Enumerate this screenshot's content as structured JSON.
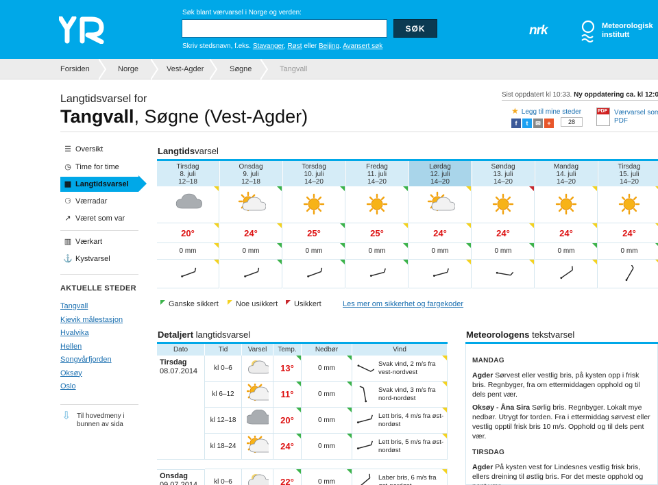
{
  "header": {
    "logo_text": "YR",
    "search_label": "Søk blant værvarsel i Norge og verden:",
    "search_value": "",
    "search_button": "SØK",
    "hint_prefix": "Skriv stedsnavn, f.eks.",
    "hint_link1": "Stavanger",
    "hint_comma": ",",
    "hint_link2": "Røst",
    "hint_or": "eller",
    "hint_link3": "Beijing",
    "hint_period": ".",
    "hint_link4": "Avansert søk",
    "nrk": "nrk",
    "met_line1": "Meteorologisk",
    "met_line2": "institutt"
  },
  "breadcrumb": [
    "Forsiden",
    "Norge",
    "Vest-Agder",
    "Søgne",
    "Tangvall"
  ],
  "title": {
    "pre": "Langtidsvarsel for",
    "place": "Tangvall",
    "rest": ", Søgne (Vest-Agder)"
  },
  "updated": {
    "last": "Sist oppdatert kl 10:33.",
    "next": "Ny oppdatering ca. kl 12:00"
  },
  "favourite": "Legg til mine steder",
  "share_count": "28",
  "pdf": {
    "badge": "PDF",
    "line1": "Værvarsel som",
    "line2": "PDF"
  },
  "sidebar": {
    "items": [
      {
        "icon": "list-icon",
        "glyph": "☰",
        "label": "Oversikt"
      },
      {
        "icon": "clock-icon",
        "glyph": "◷",
        "label": "Time for time"
      },
      {
        "icon": "calendar-icon",
        "glyph": "▦",
        "label": "Langtidsvarsel"
      },
      {
        "icon": "radar-icon",
        "glyph": "⚆",
        "label": "Værradar"
      },
      {
        "icon": "chart-icon",
        "glyph": "↗",
        "label": "Været som var"
      },
      {
        "icon": "map-icon",
        "glyph": "▥",
        "label": "Værkart"
      },
      {
        "icon": "anchor-icon",
        "glyph": "⚓",
        "label": "Kystvarsel"
      }
    ],
    "places_heading": "AKTUELLE STEDER",
    "places": [
      "Tangvall",
      "Kjevik målestasjon",
      "Hvalvika",
      "Hellen",
      "Songvårfjorden",
      "Oksøy",
      "Oslo"
    ],
    "main_menu": "Til hovedmeny i bunnen av sida"
  },
  "long_term": {
    "title_bold": "Langtids",
    "title_rest": "varsel",
    "days": [
      {
        "day": "Tirsdag",
        "date": "8. juli",
        "time": "12–18",
        "icon": "cloud",
        "temp": "20°",
        "rain": "0 mm",
        "wind_deg": -20,
        "highlight": false,
        "t_icon": "y",
        "t_temp": "y",
        "t_rain": "y",
        "t_wind": "y"
      },
      {
        "day": "Onsdag",
        "date": "9. juli",
        "time": "12–18",
        "icon": "sun-cloud",
        "temp": "24°",
        "rain": "0 mm",
        "wind_deg": -20,
        "highlight": false,
        "t_icon": "g",
        "t_temp": "y",
        "t_rain": "g",
        "t_wind": "g"
      },
      {
        "day": "Torsdag",
        "date": "10. juli",
        "time": "14–20",
        "icon": "sun",
        "temp": "25°",
        "rain": "0 mm",
        "wind_deg": -20,
        "highlight": false,
        "t_icon": "g",
        "t_temp": "g",
        "t_rain": "g",
        "t_wind": "g"
      },
      {
        "day": "Fredag",
        "date": "11. juli",
        "time": "14–20",
        "icon": "sun",
        "temp": "25°",
        "rain": "0 mm",
        "wind_deg": -15,
        "highlight": false,
        "t_icon": "g",
        "t_temp": "y",
        "t_rain": "g",
        "t_wind": "g"
      },
      {
        "day": "Lørdag",
        "date": "12. juli",
        "time": "14–20",
        "icon": "sun-cloud",
        "temp": "24°",
        "rain": "0 mm",
        "wind_deg": -15,
        "highlight": true,
        "t_icon": "y",
        "t_temp": "y",
        "t_rain": "g",
        "t_wind": "y"
      },
      {
        "day": "Søndag",
        "date": "13. juli",
        "time": "14–20",
        "icon": "sun",
        "temp": "24°",
        "rain": "0 mm",
        "wind_deg": 10,
        "highlight": false,
        "t_icon": "r",
        "t_temp": "y",
        "t_rain": "g",
        "t_wind": "y"
      },
      {
        "day": "Mandag",
        "date": "14. juli",
        "time": "14–20",
        "icon": "sun",
        "temp": "24°",
        "rain": "0 mm",
        "wind_deg": -35,
        "highlight": false,
        "t_icon": "y",
        "t_temp": "y",
        "t_rain": "g",
        "t_wind": "y"
      },
      {
        "day": "Tirsdag",
        "date": "15. juli",
        "time": "14–20",
        "icon": "sun",
        "temp": "24°",
        "rain": "0 mm",
        "wind_deg": -60,
        "highlight": false,
        "t_icon": "y",
        "t_temp": "y",
        "t_rain": "g",
        "t_wind": "y"
      }
    ],
    "legend": [
      {
        "color": "#3cb34a",
        "label": "Ganske sikkert"
      },
      {
        "color": "#f4d21f",
        "label": "Noe usikkert"
      },
      {
        "color": "#c8282d",
        "label": "Usikkert"
      }
    ],
    "legend_link": "Les mer om sikkerhet og fargekoder"
  },
  "detailed": {
    "title_bold": "Detaljert",
    "title_rest": " langtidsvarsel",
    "headers": [
      "Dato",
      "Tid",
      "Varsel",
      "Temp.",
      "Nedbør",
      "Vind"
    ],
    "groups": [
      {
        "day": "Tirsdag",
        "date": "08.07.2014"
      },
      {
        "day": "Onsdag",
        "date": "09.07.2014"
      }
    ],
    "rows": [
      {
        "time": "kl 0–6",
        "icon": "moon-cloud",
        "temp": "13°",
        "rain": "0 mm",
        "wind": "Svak vind, 2 m/s fra vest-nordvest",
        "wind_deg": 25
      },
      {
        "time": "kl 6–12",
        "icon": "sun-cloud",
        "temp": "11°",
        "rain": "0 mm",
        "wind": "Svak vind, 3 m/s fra nord-nordøst",
        "wind_deg": -100
      },
      {
        "time": "kl 12–18",
        "icon": "cloud",
        "temp": "20°",
        "rain": "0 mm",
        "wind": "Lett bris, 4 m/s fra øst-nordøst",
        "wind_deg": -15
      },
      {
        "time": "kl 18–24",
        "icon": "sun-cloud",
        "temp": "24°",
        "rain": "0 mm",
        "wind": "Lett bris, 5 m/s fra øst-nordøst",
        "wind_deg": -15
      },
      {
        "time": "kl 0–6",
        "icon": "moon-cloud",
        "temp": "22°",
        "rain": "0 mm",
        "wind": "Laber bris, 6 m/s fra øst-nordøst",
        "wind_deg": -40
      }
    ]
  },
  "met_text": {
    "title_bold": "Meteorologens",
    "title_rest": " tekstvarsel",
    "day1": "MANDAG",
    "p1_bold": "Agder",
    "p1": " Sørvest eller vestlig bris, på kysten opp i frisk bris. Regnbyger, fra om ettermiddagen opphold og til dels pent vær.",
    "p2_bold": "Oksøy - Åna Sira",
    "p2": " Sørlig bris. Regnbyger. Lokalt mye nedbør. Utrygt for torden. Fra i ettermiddag sørvest eller vestlig opptil frisk bris 10 m/s. Opphold og til dels pent vær.",
    "day2": "TIRSDAG",
    "p3_bold": "Agder",
    "p3": " På kysten vest for Lindesnes vestlig frisk bris, ellers dreining til østlig bris. For det meste opphold og pent vær."
  },
  "colors": {
    "brand": "#00a8e8",
    "temp": "#dd1111",
    "link": "#1a6fb0"
  }
}
